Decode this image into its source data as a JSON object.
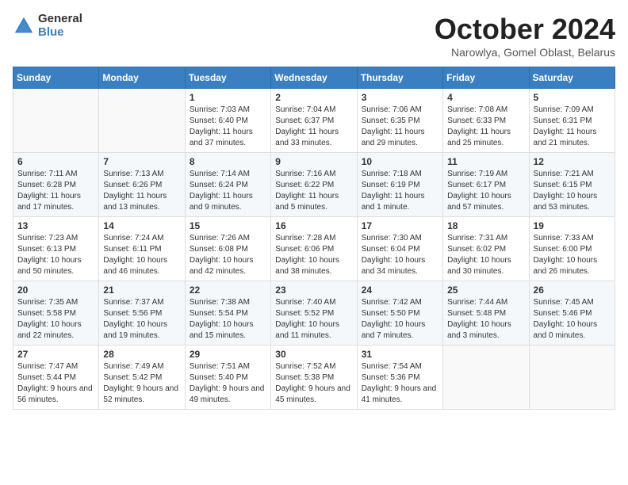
{
  "header": {
    "logo_general": "General",
    "logo_blue": "Blue",
    "month_title": "October 2024",
    "subtitle": "Narowlya, Gomel Oblast, Belarus"
  },
  "weekdays": [
    "Sunday",
    "Monday",
    "Tuesday",
    "Wednesday",
    "Thursday",
    "Friday",
    "Saturday"
  ],
  "weeks": [
    [
      null,
      null,
      {
        "day": "1",
        "sunrise": "Sunrise: 7:03 AM",
        "sunset": "Sunset: 6:40 PM",
        "daylight": "Daylight: 11 hours and 37 minutes."
      },
      {
        "day": "2",
        "sunrise": "Sunrise: 7:04 AM",
        "sunset": "Sunset: 6:37 PM",
        "daylight": "Daylight: 11 hours and 33 minutes."
      },
      {
        "day": "3",
        "sunrise": "Sunrise: 7:06 AM",
        "sunset": "Sunset: 6:35 PM",
        "daylight": "Daylight: 11 hours and 29 minutes."
      },
      {
        "day": "4",
        "sunrise": "Sunrise: 7:08 AM",
        "sunset": "Sunset: 6:33 PM",
        "daylight": "Daylight: 11 hours and 25 minutes."
      },
      {
        "day": "5",
        "sunrise": "Sunrise: 7:09 AM",
        "sunset": "Sunset: 6:31 PM",
        "daylight": "Daylight: 11 hours and 21 minutes."
      }
    ],
    [
      {
        "day": "6",
        "sunrise": "Sunrise: 7:11 AM",
        "sunset": "Sunset: 6:28 PM",
        "daylight": "Daylight: 11 hours and 17 minutes."
      },
      {
        "day": "7",
        "sunrise": "Sunrise: 7:13 AM",
        "sunset": "Sunset: 6:26 PM",
        "daylight": "Daylight: 11 hours and 13 minutes."
      },
      {
        "day": "8",
        "sunrise": "Sunrise: 7:14 AM",
        "sunset": "Sunset: 6:24 PM",
        "daylight": "Daylight: 11 hours and 9 minutes."
      },
      {
        "day": "9",
        "sunrise": "Sunrise: 7:16 AM",
        "sunset": "Sunset: 6:22 PM",
        "daylight": "Daylight: 11 hours and 5 minutes."
      },
      {
        "day": "10",
        "sunrise": "Sunrise: 7:18 AM",
        "sunset": "Sunset: 6:19 PM",
        "daylight": "Daylight: 11 hours and 1 minute."
      },
      {
        "day": "11",
        "sunrise": "Sunrise: 7:19 AM",
        "sunset": "Sunset: 6:17 PM",
        "daylight": "Daylight: 10 hours and 57 minutes."
      },
      {
        "day": "12",
        "sunrise": "Sunrise: 7:21 AM",
        "sunset": "Sunset: 6:15 PM",
        "daylight": "Daylight: 10 hours and 53 minutes."
      }
    ],
    [
      {
        "day": "13",
        "sunrise": "Sunrise: 7:23 AM",
        "sunset": "Sunset: 6:13 PM",
        "daylight": "Daylight: 10 hours and 50 minutes."
      },
      {
        "day": "14",
        "sunrise": "Sunrise: 7:24 AM",
        "sunset": "Sunset: 6:11 PM",
        "daylight": "Daylight: 10 hours and 46 minutes."
      },
      {
        "day": "15",
        "sunrise": "Sunrise: 7:26 AM",
        "sunset": "Sunset: 6:08 PM",
        "daylight": "Daylight: 10 hours and 42 minutes."
      },
      {
        "day": "16",
        "sunrise": "Sunrise: 7:28 AM",
        "sunset": "Sunset: 6:06 PM",
        "daylight": "Daylight: 10 hours and 38 minutes."
      },
      {
        "day": "17",
        "sunrise": "Sunrise: 7:30 AM",
        "sunset": "Sunset: 6:04 PM",
        "daylight": "Daylight: 10 hours and 34 minutes."
      },
      {
        "day": "18",
        "sunrise": "Sunrise: 7:31 AM",
        "sunset": "Sunset: 6:02 PM",
        "daylight": "Daylight: 10 hours and 30 minutes."
      },
      {
        "day": "19",
        "sunrise": "Sunrise: 7:33 AM",
        "sunset": "Sunset: 6:00 PM",
        "daylight": "Daylight: 10 hours and 26 minutes."
      }
    ],
    [
      {
        "day": "20",
        "sunrise": "Sunrise: 7:35 AM",
        "sunset": "Sunset: 5:58 PM",
        "daylight": "Daylight: 10 hours and 22 minutes."
      },
      {
        "day": "21",
        "sunrise": "Sunrise: 7:37 AM",
        "sunset": "Sunset: 5:56 PM",
        "daylight": "Daylight: 10 hours and 19 minutes."
      },
      {
        "day": "22",
        "sunrise": "Sunrise: 7:38 AM",
        "sunset": "Sunset: 5:54 PM",
        "daylight": "Daylight: 10 hours and 15 minutes."
      },
      {
        "day": "23",
        "sunrise": "Sunrise: 7:40 AM",
        "sunset": "Sunset: 5:52 PM",
        "daylight": "Daylight: 10 hours and 11 minutes."
      },
      {
        "day": "24",
        "sunrise": "Sunrise: 7:42 AM",
        "sunset": "Sunset: 5:50 PM",
        "daylight": "Daylight: 10 hours and 7 minutes."
      },
      {
        "day": "25",
        "sunrise": "Sunrise: 7:44 AM",
        "sunset": "Sunset: 5:48 PM",
        "daylight": "Daylight: 10 hours and 3 minutes."
      },
      {
        "day": "26",
        "sunrise": "Sunrise: 7:45 AM",
        "sunset": "Sunset: 5:46 PM",
        "daylight": "Daylight: 10 hours and 0 minutes."
      }
    ],
    [
      {
        "day": "27",
        "sunrise": "Sunrise: 7:47 AM",
        "sunset": "Sunset: 5:44 PM",
        "daylight": "Daylight: 9 hours and 56 minutes."
      },
      {
        "day": "28",
        "sunrise": "Sunrise: 7:49 AM",
        "sunset": "Sunset: 5:42 PM",
        "daylight": "Daylight: 9 hours and 52 minutes."
      },
      {
        "day": "29",
        "sunrise": "Sunrise: 7:51 AM",
        "sunset": "Sunset: 5:40 PM",
        "daylight": "Daylight: 9 hours and 49 minutes."
      },
      {
        "day": "30",
        "sunrise": "Sunrise: 7:52 AM",
        "sunset": "Sunset: 5:38 PM",
        "daylight": "Daylight: 9 hours and 45 minutes."
      },
      {
        "day": "31",
        "sunrise": "Sunrise: 7:54 AM",
        "sunset": "Sunset: 5:36 PM",
        "daylight": "Daylight: 9 hours and 41 minutes."
      },
      null,
      null
    ]
  ]
}
